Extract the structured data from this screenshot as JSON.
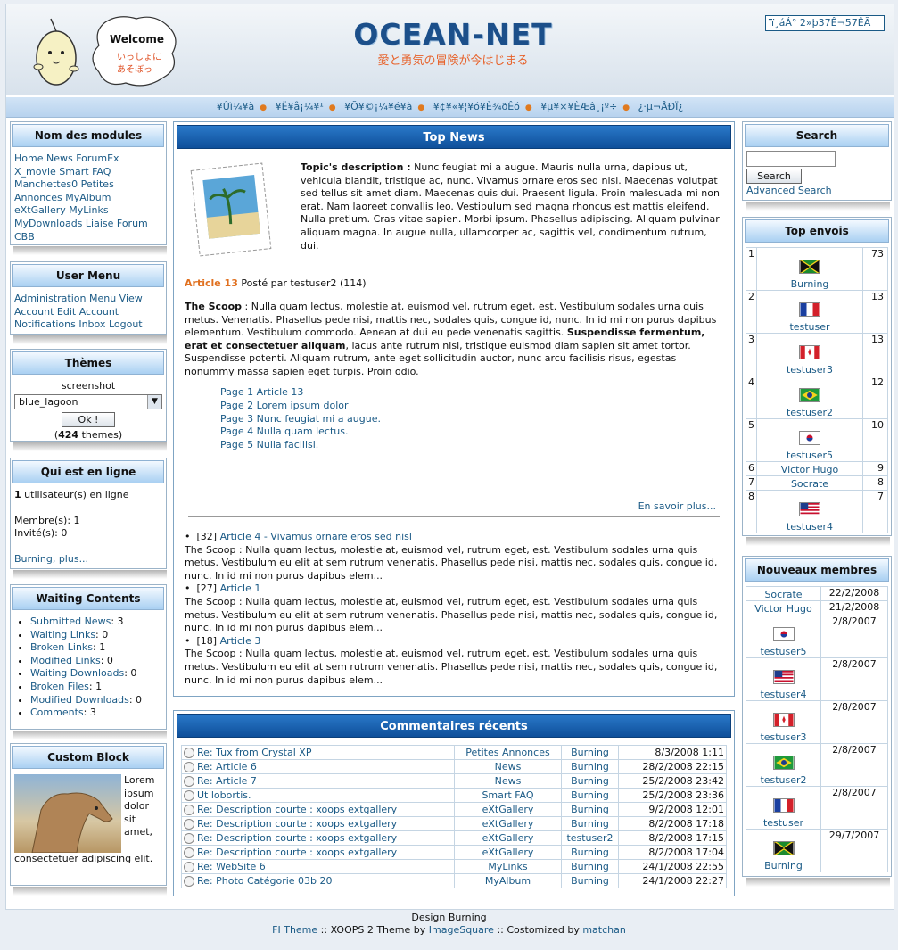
{
  "header": {
    "logo_title": "OCEAN-NET",
    "logo_subtitle": "愛と勇気の冒険が今はじまる",
    "mascot_welcome": "Welcome",
    "mascot_line1": "いっしょに",
    "mascot_line2": "あそぼっ",
    "top_right_text": "ïï¸áÁ° 2»þ37Ê¬57ÊÃ"
  },
  "nav": {
    "items": [
      "¥Ûì¼¥à",
      "¥Ë¥å¡¼¥¹",
      "¥Õ¥©¡¼¥é¥à",
      "¥¢¥«¥¦¥ó¥È¾ðÊó",
      "¥µ¥×¥ÈÆâ¸¡º÷",
      "¿·µ¬ÅÐÏ¿"
    ]
  },
  "modules": {
    "title": "Nom des modules",
    "lines": [
      "Home News ForumEx",
      "X_movie Smart FAQ",
      "Manchettes0 Petites",
      "Annonces MyAlbum",
      "eXtGallery MyLinks",
      "MyDownloads Liaise Forum",
      "CBB"
    ]
  },
  "usermenu": {
    "title": "User Menu",
    "lines": [
      "Administration Menu View",
      "Account Edit Account",
      "Notifications Inbox Logout"
    ]
  },
  "themes": {
    "title": "Thèmes",
    "label": "screenshot",
    "selected": "blue_lagoon",
    "ok": "Ok !",
    "count_pre": "(",
    "count": "424",
    "count_post": " themes)"
  },
  "online": {
    "title": "Qui est en ligne",
    "users_count": "1",
    "users_text": " utilisateur(s) en ligne",
    "members": "Membre(s): 1",
    "guests": "Invité(s): 0",
    "more": "Burning, plus..."
  },
  "waiting": {
    "title": "Waiting Contents",
    "items": [
      {
        "label": "Submitted News",
        "value": ": 3"
      },
      {
        "label": "Waiting Links",
        "value": ": 0"
      },
      {
        "label": "Broken Links",
        "value": ": 1"
      },
      {
        "label": "Modified Links",
        "value": ": 0"
      },
      {
        "label": "Waiting Downloads",
        "value": ": 0"
      },
      {
        "label": "Broken Files",
        "value": ": 1"
      },
      {
        "label": "Modified Downloads",
        "value": ": 0"
      },
      {
        "label": "Comments",
        "value": ": 3"
      }
    ]
  },
  "custom": {
    "title": "Custom Block",
    "text": "Lorem ipsum dolor sit amet, consectetuer adipiscing elit."
  },
  "topnews": {
    "title": "Top News",
    "desc_label": "Topic's description :",
    "desc_text": " Nunc feugiat mi a augue. Mauris nulla urna, dapibus ut, vehicula blandit, tristique ac, nunc. Vivamus ornare eros sed nisl. Maecenas volutpat sed tellus sit amet diam. Maecenas quis dui. Praesent ligula. Proin malesuada mi non erat. Nam laoreet convallis leo. Vestibulum sed magna rhoncus est mattis eleifend. Nulla pretium. Cras vitae sapien. Morbi ipsum. Phasellus adipiscing. Aliquam pulvinar aliquam magna. In augue nulla, ullamcorper ac, sagittis vel, condimentum rutrum, dui.",
    "article_link": "Article 13",
    "posted_by": " Posté par testuser2 (114)",
    "scoop_label": "The Scoop",
    "scoop_text1": " : Nulla quam lectus, molestie at, euismod vel, rutrum eget, est. Vestibulum sodales urna quis metus. Venenatis. Phasellus pede nisi, mattis nec, sodales quis, congue id, nunc. In id mi non purus dapibus elementum. Vestibulum commodo. Aenean at dui eu pede venenatis sagittis. ",
    "scoop_bold": "Suspendisse fermentum, erat et consectetuer aliquam",
    "scoop_text2": ", lacus ante rutrum nisi, tristique euismod diam sapien sit amet tortor. Suspendisse potenti. Aliquam rutrum, ante eget sollicitudin auctor, nunc arcu facilisis risus, egestas nonummy massa sapien eget turpis. Proin odio.",
    "pages": [
      "Page 1 Article 13",
      "Page 2 Lorem ipsum dolor",
      "Page 3 Nunc feugiat mi a augue.",
      "Page 4 Nulla quam lectus.",
      "Page 5 Nulla facilisi."
    ],
    "more": "En savoir plus...",
    "others": [
      {
        "count": "[32] ",
        "link": "Article 4 - Vivamus ornare eros sed nisl",
        "text": "The Scoop : Nulla quam lectus, molestie at, euismod vel, rutrum eget, est. Vestibulum sodales urna quis metus. Vestibulum eu elit at sem rutrum venenatis. Phasellus pede nisi, mattis nec, sodales quis, congue id, nunc. In id mi non purus dapibus elem..."
      },
      {
        "count": "[27] ",
        "link": "Article 1",
        "text": "The Scoop : Nulla quam lectus, molestie at, euismod vel, rutrum eget, est. Vestibulum sodales urna quis metus. Vestibulum eu elit at sem rutrum venenatis. Phasellus pede nisi, mattis nec, sodales quis, congue id, nunc. In id mi non purus dapibus elem..."
      },
      {
        "count": "[18] ",
        "link": "Article 3",
        "text": "The Scoop : Nulla quam lectus, molestie at, euismod vel, rutrum eget, est. Vestibulum sodales urna quis metus. Vestibulum eu elit at sem rutrum venenatis. Phasellus pede nisi, mattis nec, sodales quis, congue id, nunc. In id mi non purus dapibus elem..."
      }
    ]
  },
  "comments": {
    "title": "Commentaires récents",
    "rows": [
      {
        "title": "Re: Tux from Crystal XP",
        "module": "Petites Annonces",
        "user": "Burning",
        "date": "8/3/2008 1:11"
      },
      {
        "title": "Re: Article 6",
        "module": "News",
        "user": "Burning",
        "date": "28/2/2008 22:15"
      },
      {
        "title": "Re: Article 7",
        "module": "News",
        "user": "Burning",
        "date": "25/2/2008 23:42"
      },
      {
        "title": "Ut lobortis.",
        "module": "Smart FAQ",
        "user": "Burning",
        "date": "25/2/2008 23:36"
      },
      {
        "title": "Re: Description courte : xoops extgallery",
        "module": "eXtGallery",
        "user": "Burning",
        "date": "9/2/2008 12:01"
      },
      {
        "title": "Re: Description courte : xoops extgallery",
        "module": "eXtGallery",
        "user": "Burning",
        "date": "8/2/2008 17:18"
      },
      {
        "title": "Re: Description courte : xoops extgallery",
        "module": "eXtGallery",
        "user": "testuser2",
        "date": "8/2/2008 17:15"
      },
      {
        "title": "Re: Description courte : xoops extgallery",
        "module": "eXtGallery",
        "user": "Burning",
        "date": "8/2/2008 17:04"
      },
      {
        "title": "Re: WebSite 6",
        "module": "MyLinks",
        "user": "Burning",
        "date": "24/1/2008 22:55"
      },
      {
        "title": "Re: Photo Catégorie 03b 20",
        "module": "MyAlbum",
        "user": "Burning",
        "date": "24/1/2008 22:27"
      }
    ]
  },
  "search": {
    "title": "Search",
    "value": "",
    "button": "Search",
    "advanced": "Advanced Search"
  },
  "topposters": {
    "title": "Top envois",
    "rows": [
      {
        "rank": "1",
        "user": "Burning",
        "posts": "73",
        "flag": "jamaica"
      },
      {
        "rank": "2",
        "user": "testuser",
        "posts": "13",
        "flag": "france"
      },
      {
        "rank": "3",
        "user": "testuser3",
        "posts": "13",
        "flag": "canada"
      },
      {
        "rank": "4",
        "user": "testuser2",
        "posts": "12",
        "flag": "brazil"
      },
      {
        "rank": "5",
        "user": "testuser5",
        "posts": "10",
        "flag": "korea"
      },
      {
        "rank": "6",
        "user": "Victor Hugo",
        "posts": "9",
        "flag": ""
      },
      {
        "rank": "7",
        "user": "Socrate",
        "posts": "8",
        "flag": ""
      },
      {
        "rank": "8",
        "user": "testuser4",
        "posts": "7",
        "flag": "usa"
      }
    ]
  },
  "newmembers": {
    "title": "Nouveaux membres",
    "rows": [
      {
        "user": "Socrate",
        "date": "22/2/2008",
        "flag": ""
      },
      {
        "user": "Victor Hugo",
        "date": "21/2/2008",
        "flag": ""
      },
      {
        "user": "testuser5",
        "date": "2/8/2007",
        "flag": "korea"
      },
      {
        "user": "testuser4",
        "date": "2/8/2007",
        "flag": "usa"
      },
      {
        "user": "testuser3",
        "date": "2/8/2007",
        "flag": "canada"
      },
      {
        "user": "testuser2",
        "date": "2/8/2007",
        "flag": "brazil"
      },
      {
        "user": "testuser",
        "date": "2/8/2007",
        "flag": "france"
      },
      {
        "user": "Burning",
        "date": "29/7/2007",
        "flag": "jamaica"
      }
    ]
  },
  "footer": {
    "line1": "Design Burning",
    "fi_theme": "FI Theme",
    "sep1": " :: XOOPS 2 Theme by ",
    "imagesquare": "ImageSquare",
    "sep2": " :: Costomized by ",
    "matchan": "matchan"
  }
}
